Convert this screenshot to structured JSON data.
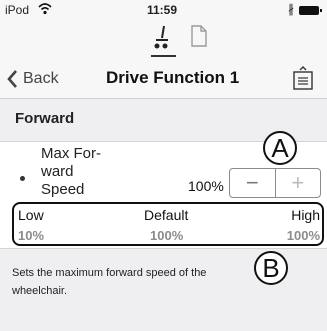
{
  "status_bar": {
    "carrier": "iPod",
    "time": "11:59",
    "bluetooth_symbol": "∦"
  },
  "tabs": [
    {
      "name": "drive-function-tab",
      "icon": "wheelchair-tilt-icon",
      "selected": true
    },
    {
      "name": "document-tab",
      "icon": "document-icon",
      "selected": false
    }
  ],
  "nav": {
    "back_label": "Back",
    "title": "Drive Function 1",
    "action_icon": "share-icon"
  },
  "section": {
    "title": "Forward"
  },
  "setting": {
    "name": "Max Forward Speed",
    "name_lines": [
      "Max For-",
      "ward",
      "Speed"
    ],
    "value": "100%",
    "minus_symbol": "−",
    "plus_symbol": "+"
  },
  "range": {
    "low_label": "Low",
    "default_label": "Default",
    "high_label": "High",
    "low_value": "10%",
    "default_value": "100%",
    "high_value": "100%"
  },
  "callouts": {
    "a": "A",
    "b": "B"
  },
  "description": "Sets the maximum forward speed of the wheelchair.",
  "colors": {
    "nav_background": "#f7f7f7",
    "section_background": "#efeff1",
    "range_value_gray": "#8c8c8c"
  }
}
